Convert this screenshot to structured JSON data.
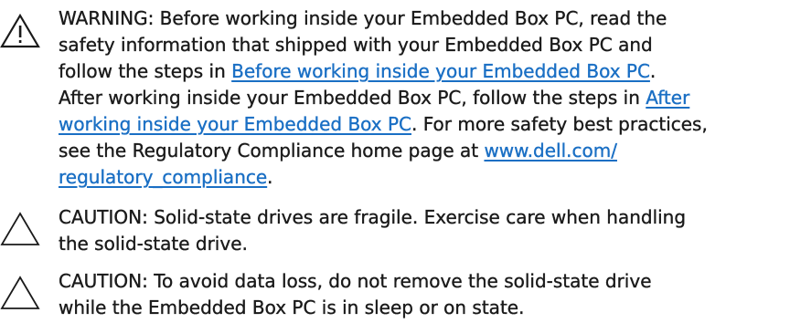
{
  "warning": {
    "icon": "warning-triangle-icon",
    "line1": "WARNING: Before working inside your Embedded Box PC, read the",
    "line2": "safety information that shipped with your Embedded Box PC and",
    "line3_text": "follow the steps in ",
    "link_before": "Before working inside your Embedded Box PC",
    "line3_end": ".",
    "line4_text": "After working inside your Embedded Box PC, follow the steps in ",
    "link_after_part1": "After",
    "link_after_part2": "working inside your Embedded Box PC",
    "line5_end": ". For more safety best practices,",
    "line6_text": "see the Regulatory Compliance home page at ",
    "link_url_part1": "www.dell.com/",
    "link_url_part2": "regulatory_compliance",
    "line7_end": "."
  },
  "caution1": {
    "icon": "caution-triangle-icon",
    "line1": "CAUTION: Solid-state drives are fragile. Exercise care when handling",
    "line2": "the solid-state drive."
  },
  "caution2": {
    "icon": "caution-triangle-icon",
    "line1": "CAUTION: To avoid data loss, do not remove the solid-state drive",
    "line2": "while the Embedded Box PC is in sleep or on state."
  },
  "colors": {
    "text": "#1a1a1a",
    "link": "#1a6fc4"
  }
}
